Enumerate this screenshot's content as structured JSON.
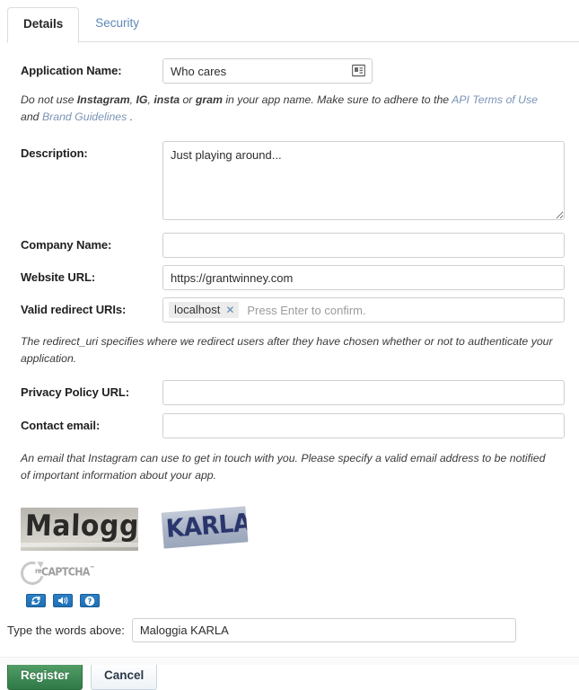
{
  "tabs": [
    {
      "label": "Details",
      "active": true
    },
    {
      "label": "Security",
      "active": false
    }
  ],
  "fields": {
    "application_name": {
      "label": "Application Name:",
      "value": "Who cares",
      "icon": "contact-card-icon"
    },
    "description": {
      "label": "Description:",
      "value": "Just playing around..."
    },
    "company_name": {
      "label": "Company Name:",
      "value": ""
    },
    "website_url": {
      "label": "Website URL:",
      "value": "https://grantwinney.com"
    },
    "valid_redirect_uris": {
      "label": "Valid redirect URIs:",
      "tags": [
        "localhost"
      ],
      "placeholder": "Press Enter to confirm."
    },
    "privacy_policy_url": {
      "label": "Privacy Policy URL:",
      "value": ""
    },
    "contact_email": {
      "label": "Contact email:",
      "value": ""
    }
  },
  "help": {
    "app_name_prefix": "Do not use ",
    "app_name_b1": "Instagram",
    "app_name_sep1": ", ",
    "app_name_b2": "IG",
    "app_name_sep2": ", ",
    "app_name_b3": "insta",
    "app_name_sep3": " or ",
    "app_name_b4": "gram",
    "app_name_mid": " in your app name. Make sure to adhere to the ",
    "app_name_link1": "API Terms of Use",
    "app_name_and": " and ",
    "app_name_link2": "Brand Guidelines",
    "app_name_end": " .",
    "redirect": "The redirect_uri specifies where we redirect users after they have chosen whether or not to authenticate your application.",
    "email": "An email that Instagram can use to get in touch with you. Please specify a valid email address to be notified of important information about your app."
  },
  "captcha": {
    "word1": "Maloggia",
    "word2": "KARLA",
    "brand_pre": "re",
    "brand_main": "CAPTCHA",
    "brand_tm": "™",
    "buttons": [
      {
        "name": "refresh-challenge-button",
        "glyph": "refresh"
      },
      {
        "name": "audio-challenge-button",
        "glyph": "audio"
      },
      {
        "name": "help-button",
        "glyph": "help"
      }
    ],
    "type_label": "Type the words above:",
    "typed_value": "Maloggia KARLA"
  },
  "actions": {
    "register": "Register",
    "cancel": "Cancel"
  },
  "colors": {
    "accent_link": "#7a93b5",
    "tab_inactive": "#5d87b5",
    "primary_button": "#3f8a56",
    "captcha_button": "#1f6fb4",
    "tag_remove": "#5d87b5"
  }
}
